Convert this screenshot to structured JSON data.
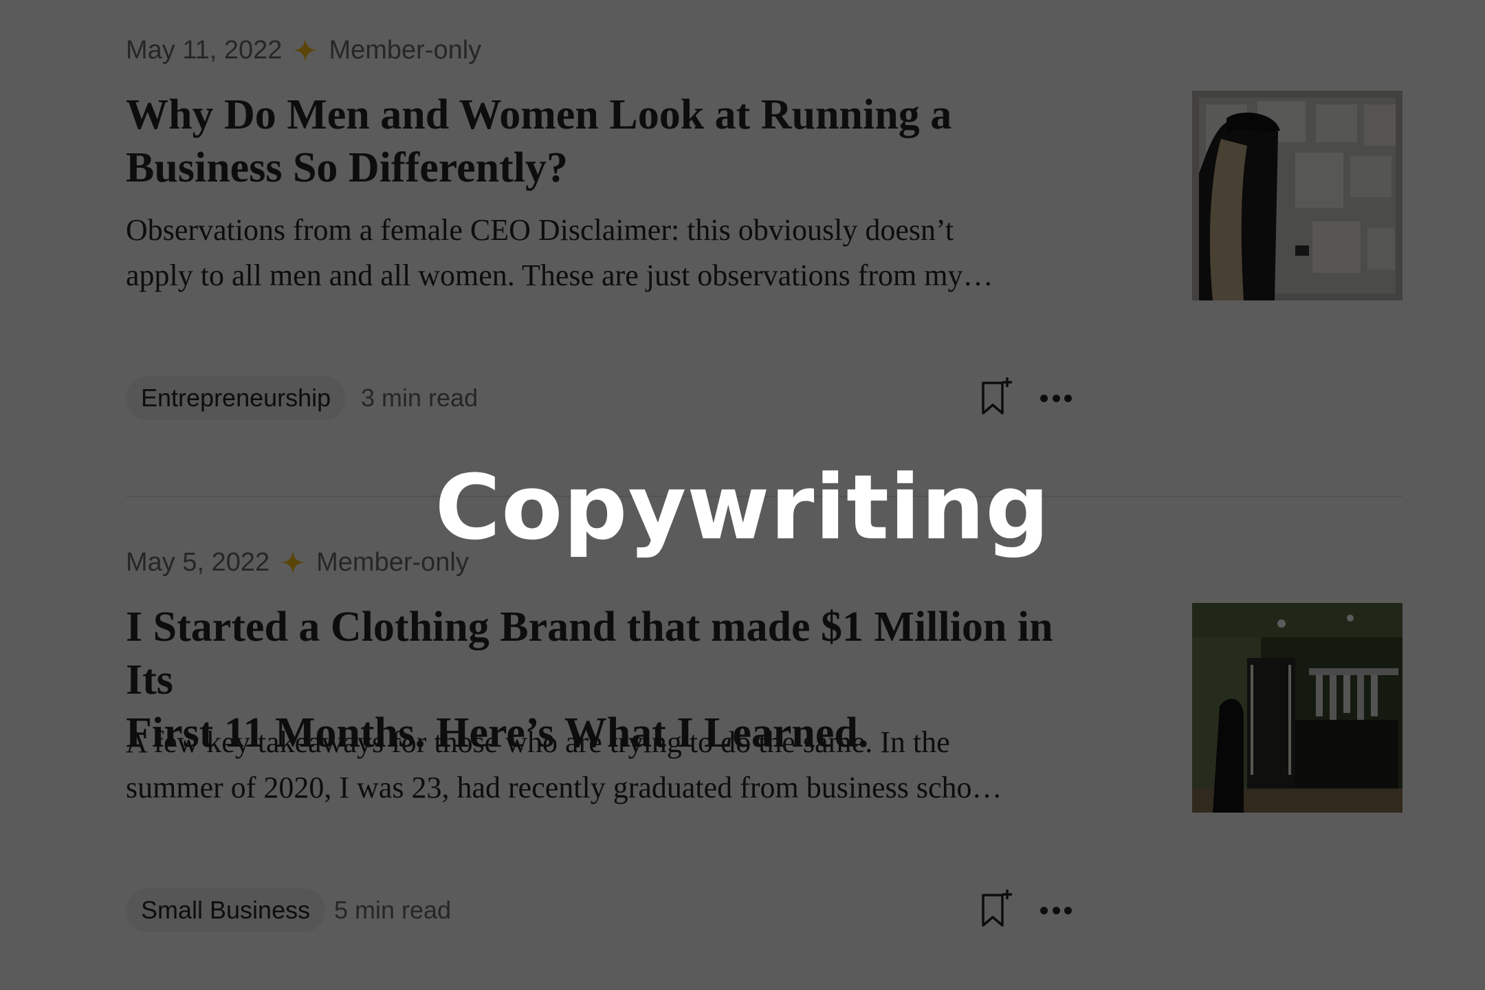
{
  "overlay": {
    "title": "Copywriting"
  },
  "articles": [
    {
      "date": "May 11, 2022",
      "badge": "Member-only",
      "title_line1": "Why Do Men and Women Look at Running a",
      "title_line2": "Business So Differently?",
      "excerpt_line1": "Observations from a female CEO Disclaimer: this obviously doesn’t",
      "excerpt_line2": "apply to all men and all women. These are just observations from my…",
      "tag": "Entrepreneurship",
      "read_time": "3 min read"
    },
    {
      "date": "May 5, 2022",
      "badge": "Member-only",
      "title_line1": "I Started a Clothing Brand that made $1 Million in Its",
      "title_line2": "First 11 Months. Here’s What I Learned.",
      "excerpt_line1": "A few key takeaways for those who are trying to do the same. In the",
      "excerpt_line2": "summer of 2020, I was 23, had recently graduated from business scho…",
      "tag": "Small Business",
      "read_time": "5 min read"
    }
  ],
  "colors": {
    "star": "#ffc017",
    "text": "#242424",
    "muted": "#6b6b6b",
    "chip": "#f2f2f2"
  }
}
